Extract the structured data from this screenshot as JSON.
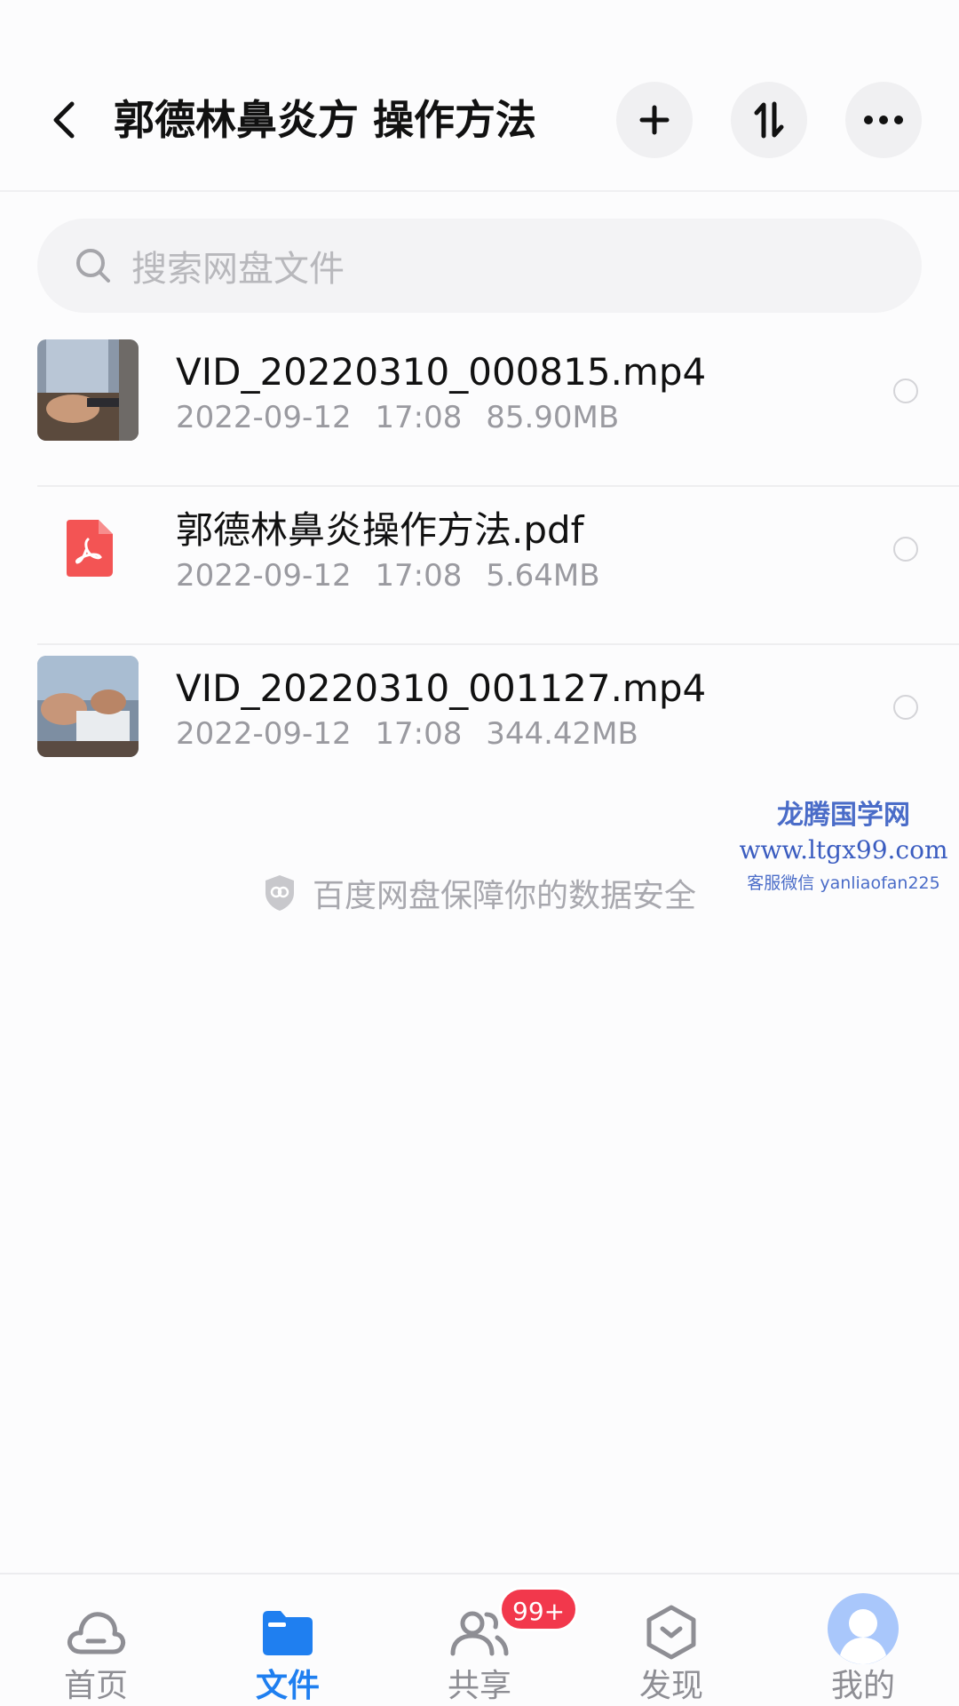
{
  "header": {
    "title": "郭德林鼻炎方 操作方法",
    "back_icon": "chevron-left-icon",
    "actions": [
      "plus-icon",
      "sort-icon",
      "more-icon"
    ]
  },
  "search": {
    "placeholder": "搜索网盘文件",
    "icon": "search-icon"
  },
  "files": [
    {
      "name": "VID_20220310_000815.mp4",
      "date": "2022-09-12",
      "time": "17:08",
      "size": "85.90MB",
      "type": "video"
    },
    {
      "name": "郭德林鼻炎操作方法.pdf",
      "date": "2022-09-12",
      "time": "17:08",
      "size": "5.64MB",
      "type": "pdf"
    },
    {
      "name": "VID_20220310_001127.mp4",
      "date": "2022-09-12",
      "time": "17:08",
      "size": "344.42MB",
      "type": "video"
    }
  ],
  "safety_note": "百度网盘保障你的数据安全",
  "watermark": {
    "title": "龙腾国学网",
    "url": "www.ltgx99.com",
    "wechat": "客服微信 yanliaofan225"
  },
  "nav": {
    "items": [
      {
        "label": "首页",
        "icon": "cloud-icon"
      },
      {
        "label": "文件",
        "icon": "folder-icon"
      },
      {
        "label": "共享",
        "icon": "users-icon",
        "badge": "99+"
      },
      {
        "label": "发现",
        "icon": "hexagon-icon"
      },
      {
        "label": "我的",
        "icon": "avatar-icon"
      }
    ],
    "active": "文件"
  },
  "colors": {
    "accent": "#1f7ff0",
    "badge": "#f2384c",
    "pdf": "#f35454"
  }
}
